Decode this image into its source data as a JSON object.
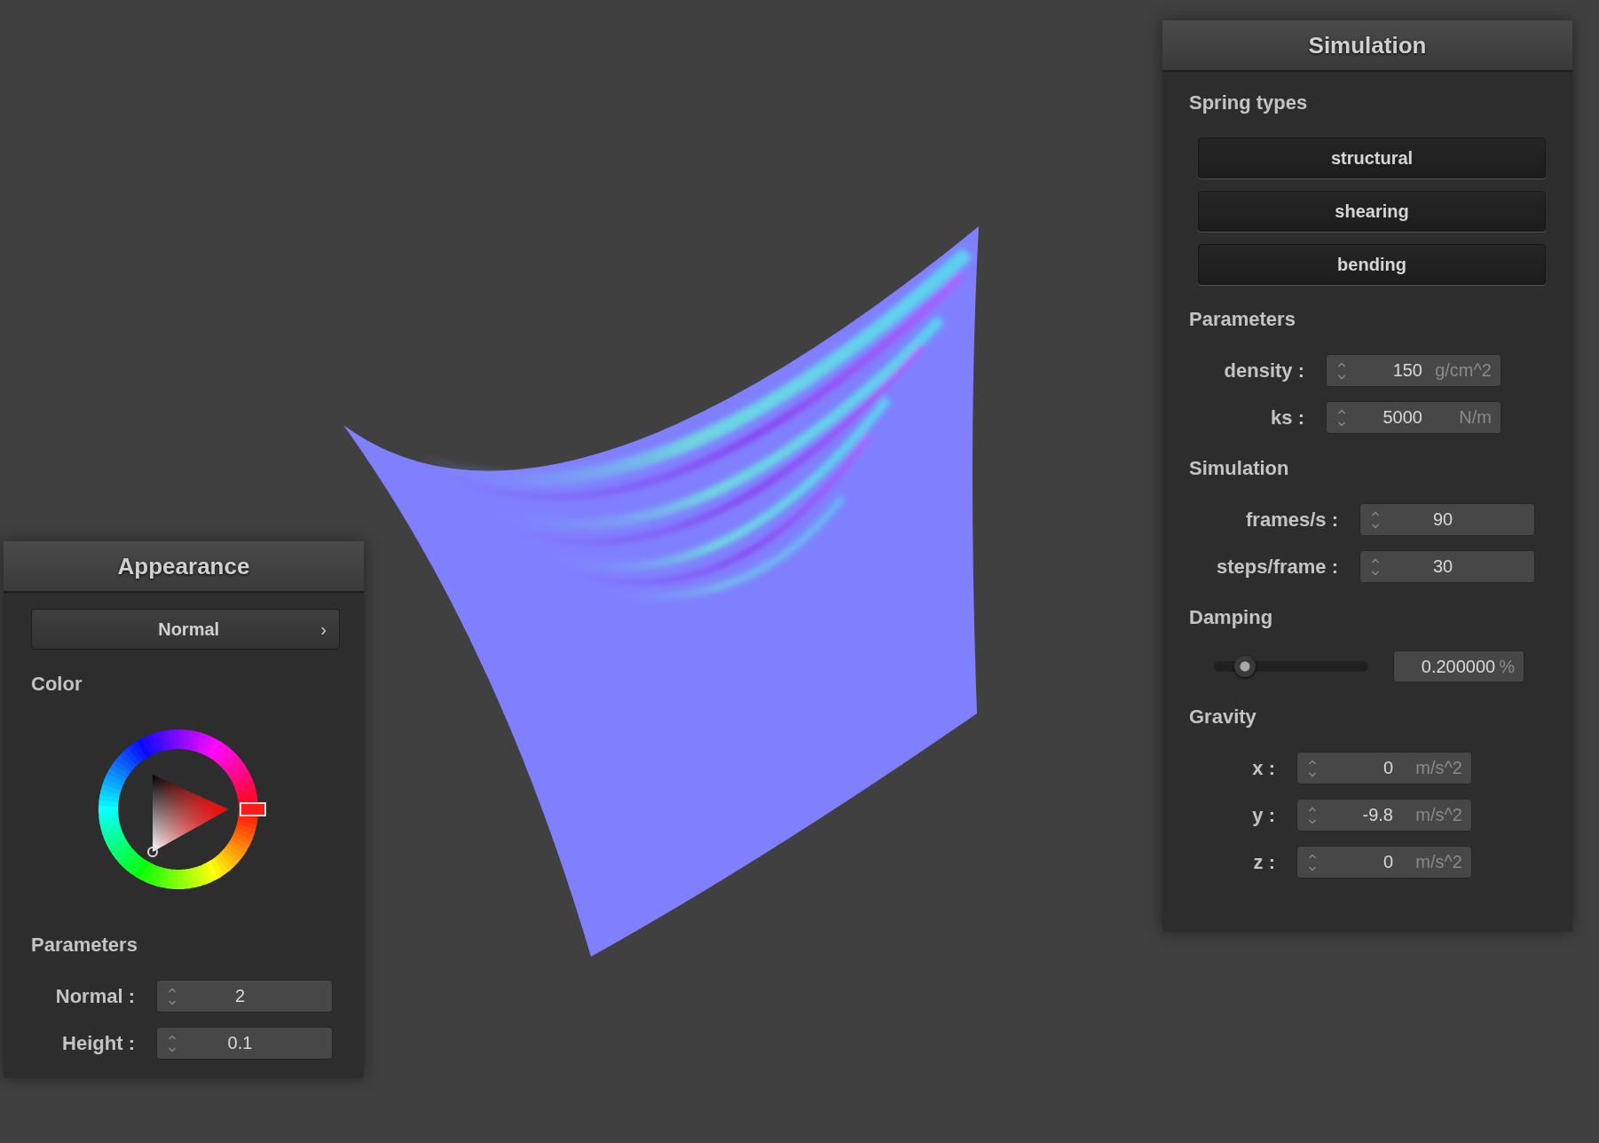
{
  "simulation_panel": {
    "title": "Simulation",
    "sections": [
      {
        "kind": "buttons",
        "heading": "Spring types",
        "buttons": [
          "structural",
          "shearing",
          "bending"
        ]
      },
      {
        "kind": "fields",
        "heading": "Parameters",
        "fields": [
          {
            "label": "density :",
            "value": "150",
            "unit": "g/cm^2"
          },
          {
            "label": "ks :",
            "value": "5000",
            "unit": "N/m"
          }
        ]
      },
      {
        "kind": "fields",
        "heading": "Simulation",
        "fields": [
          {
            "label": "frames/s :",
            "value": "90"
          },
          {
            "label": "steps/frame :",
            "value": "30"
          }
        ]
      },
      {
        "kind": "slider",
        "heading": "Damping",
        "level": 0.2,
        "value": "0.200000",
        "unit": "%"
      },
      {
        "kind": "fields",
        "heading": "Gravity",
        "fields": [
          {
            "label": "x :",
            "value": "0",
            "unit": "m/s^2"
          },
          {
            "label": "y :",
            "value": "-9.8",
            "unit": "m/s^2"
          },
          {
            "label": "z :",
            "value": "0",
            "unit": "m/s^2"
          }
        ]
      }
    ]
  },
  "appearance_panel": {
    "title": "Appearance",
    "mode_button": {
      "label": "Normal",
      "chevron": "›"
    },
    "color_heading": "Color",
    "parameters_heading": "Parameters",
    "fields": [
      {
        "label": "Normal :",
        "value": "2"
      },
      {
        "label": "Height :",
        "value": "0.1"
      }
    ]
  }
}
